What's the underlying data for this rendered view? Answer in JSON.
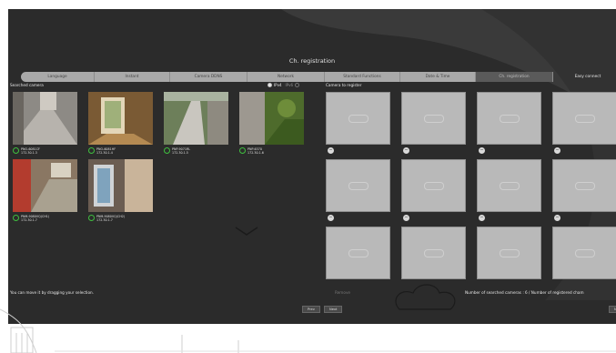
{
  "header": {
    "title": "Ch. registration"
  },
  "tabs": [
    {
      "label": "Language",
      "state": "normal"
    },
    {
      "label": "Instant",
      "state": "normal"
    },
    {
      "label": "Camera DDNS",
      "state": "normal"
    },
    {
      "label": "Network",
      "state": "normal"
    },
    {
      "label": "Standard Functions",
      "state": "normal"
    },
    {
      "label": "Date & Time",
      "state": "normal"
    },
    {
      "label": "Ch. registration",
      "state": "active"
    },
    {
      "label": "Easy connect",
      "state": "easy"
    }
  ],
  "searched": {
    "label": "Searched camera",
    "ip_options": [
      {
        "label": "IPv4",
        "selected": true
      },
      {
        "label": "IPv6",
        "selected": false
      }
    ],
    "cameras": [
      {
        "model": "PNO-6081CF",
        "ip": "172.30.1.3"
      },
      {
        "model": "PNO-6081HF",
        "ip": "172.30.1.4"
      },
      {
        "model": "PNP-9071RL",
        "ip": "172.30.1.5"
      },
      {
        "model": "PNP-6370",
        "ip": "172.30.1.6"
      },
      {
        "model": "PNM-9080VQ(CH1)",
        "ip": "172.30.1.7"
      },
      {
        "model": "PNM-9080VQ(CH2)",
        "ip": "172.30.1.7"
      }
    ]
  },
  "register": {
    "label": "Camera to register",
    "remove_symbol": "−",
    "slot_count": 12
  },
  "footer": {
    "hint": "You can move it by dragging your selection.",
    "buttons": [
      {
        "label": "Prev"
      },
      {
        "label": "Next"
      }
    ],
    "remove_label": "Remove",
    "count_text": "Number of searched cameras : 6 / Number of registered cham",
    "next_label": "Ne"
  },
  "colors": {
    "panel": "#2b2b2b",
    "slot": "#b9b9b9",
    "status": "#3fbf3f"
  }
}
